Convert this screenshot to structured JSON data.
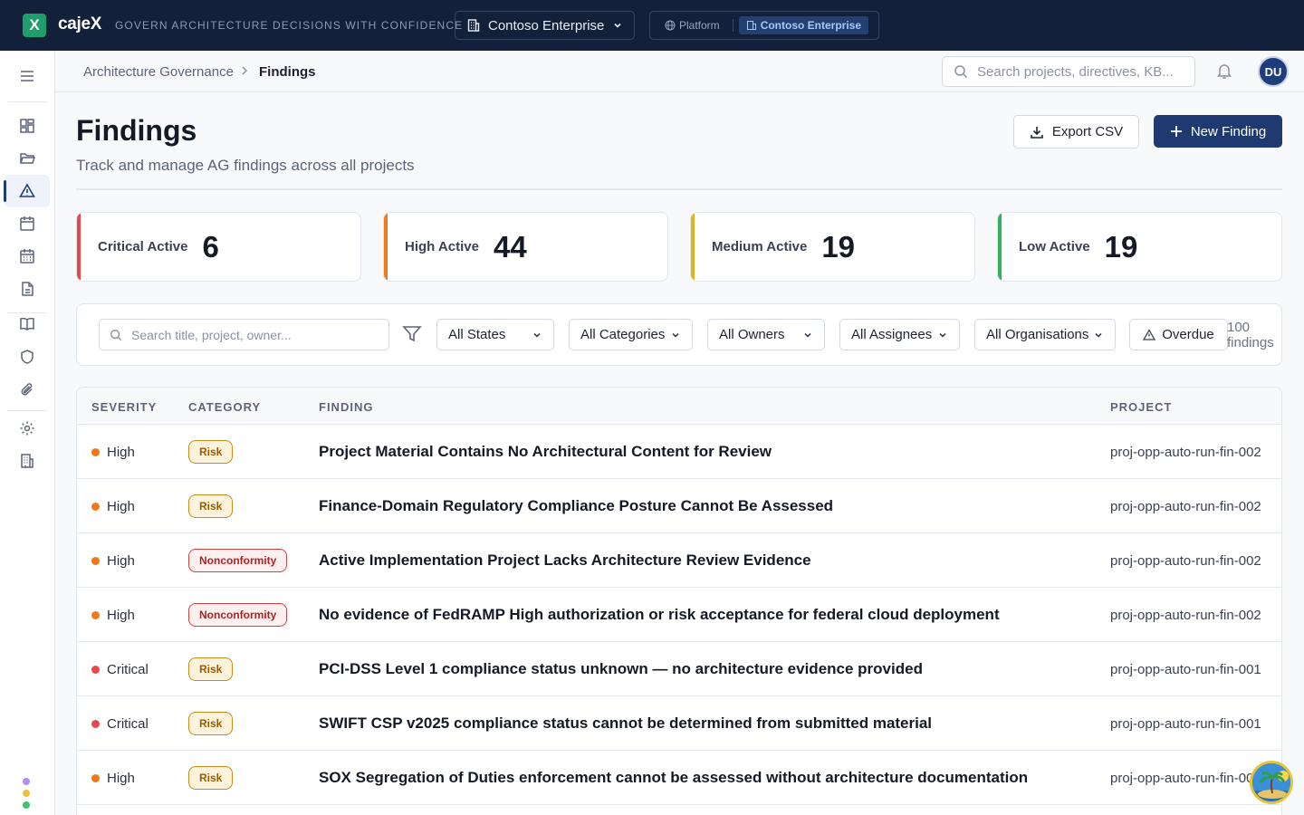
{
  "app": {
    "logo_letter": "X",
    "brand": "cajeX",
    "tagline": "GOVERN ARCHITECTURE DECISIONS WITH CONFIDENCE",
    "org_select": "Contoso Enterprise",
    "scope": {
      "platform": "Platform",
      "enterprise": "Contoso Enterprise"
    }
  },
  "sidebar": {
    "items": [
      "menu-icon",
      "dashboard-icon",
      "folder-icon",
      "findings-icon",
      "calendar-icon",
      "schedule-icon",
      "document-icon",
      "book-icon",
      "shield-icon",
      "paperclip-icon",
      "settings-icon",
      "building-icon"
    ],
    "active": "findings-icon"
  },
  "header": {
    "breadcrumb_parent": "Architecture Governance",
    "breadcrumb_current": "Findings",
    "search_placeholder": "Search projects, directives, KB...",
    "avatar_initials": "DU"
  },
  "page": {
    "title": "Findings",
    "subtitle": "Track and manage AG findings across all projects",
    "export_label": "Export CSV",
    "new_label": "New Finding"
  },
  "stats": [
    {
      "label": "Critical Active",
      "value": "6",
      "color": "#e5484d"
    },
    {
      "label": "High Active",
      "value": "44",
      "color": "#f07a1a"
    },
    {
      "label": "Medium Active",
      "value": "19",
      "color": "#e6b01e"
    },
    {
      "label": "Low Active",
      "value": "19",
      "color": "#2fb35a"
    }
  ],
  "filters": {
    "search_placeholder": "Search title, project, owner...",
    "states": "All States",
    "categories": "All Categories",
    "owners": "All Owners",
    "assignees": "All Assignees",
    "organisations": "All Organisations",
    "overdue": "Overdue",
    "count": "100 findings"
  },
  "table": {
    "columns": [
      "SEVERITY",
      "CATEGORY",
      "FINDING",
      "PROJECT"
    ],
    "rows": [
      {
        "severity": "High",
        "category": "Risk",
        "finding": "Project Material Contains No Architectural Content for Review",
        "project": "proj-opp-auto-run-fin-002"
      },
      {
        "severity": "High",
        "category": "Risk",
        "finding": "Finance-Domain Regulatory Compliance Posture Cannot Be Assessed",
        "project": "proj-opp-auto-run-fin-002"
      },
      {
        "severity": "High",
        "category": "Nonconformity",
        "finding": "Active Implementation Project Lacks Architecture Review Evidence",
        "project": "proj-opp-auto-run-fin-002"
      },
      {
        "severity": "High",
        "category": "Nonconformity",
        "finding": "No evidence of FedRAMP High authorization or risk acceptance for federal cloud deployment",
        "project": "proj-opp-auto-run-fin-002"
      },
      {
        "severity": "Critical",
        "category": "Risk",
        "finding": "PCI-DSS Level 1 compliance status unknown — no architecture evidence provided",
        "project": "proj-opp-auto-run-fin-001"
      },
      {
        "severity": "Critical",
        "category": "Risk",
        "finding": "SWIFT CSP v2025 compliance status cannot be determined from submitted material",
        "project": "proj-opp-auto-run-fin-001"
      },
      {
        "severity": "High",
        "category": "Risk",
        "finding": "SOX Segregation of Duties enforcement cannot be assessed without architecture documentation",
        "project": "proj-opp-auto-run-fin-001"
      }
    ]
  },
  "colors": {
    "critical": "#e5484d",
    "high": "#f07a1a",
    "primary": "#1f3a70",
    "topbar": "#13203a"
  }
}
